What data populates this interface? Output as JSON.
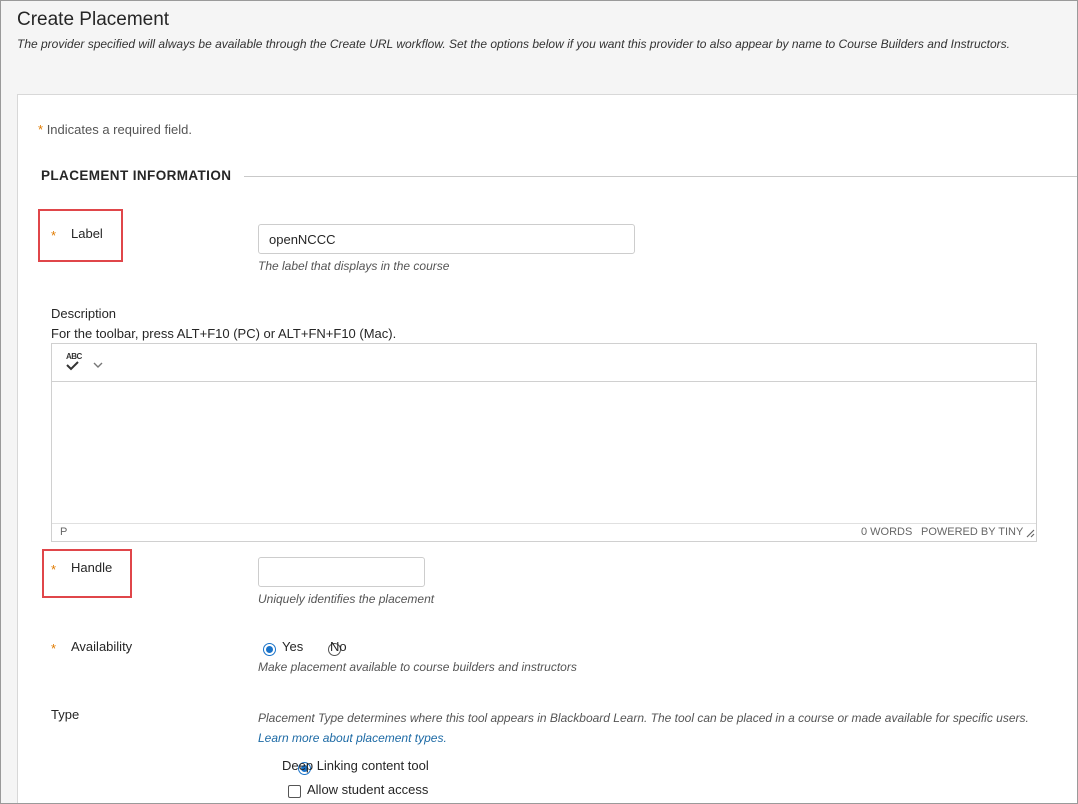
{
  "header": {
    "title": "Create Placement",
    "subtitle": "The provider specified will always be available through the Create URL workflow. Set the options below if you want this provider to also appear by name to Course Builders and Instructors."
  },
  "form": {
    "required_star": "*",
    "required_note": "Indicates a required field.",
    "section_title": "PLACEMENT INFORMATION",
    "label": {
      "title": "Label",
      "value": "openNCCC",
      "hint": "The label that displays in the course"
    },
    "description": {
      "title": "Description",
      "toolbar_help": "For the toolbar, press ALT+F10 (PC) or ALT+FN+F10 (Mac).",
      "spellcheck_icon_text": "ABC",
      "status_path": "P",
      "word_count": "0 WORDS",
      "powered_by": "POWERED BY TINY"
    },
    "handle": {
      "title": "Handle",
      "value": "",
      "hint": "Uniquely identifies the placement"
    },
    "availability": {
      "title": "Availability",
      "options": [
        "Yes",
        "No"
      ],
      "selected": "Yes",
      "hint": "Make placement available to course builders and instructors"
    },
    "type": {
      "title": "Type",
      "description": "Placement Type determines where this tool appears in Blackboard Learn. The tool can be placed in a course or made available for specific users.",
      "link_text": "Learn more about placement types.",
      "option_selected": "Deep Linking content tool",
      "allow_student_access": "Allow student access",
      "allow_student_access_checked": false
    }
  },
  "colors": {
    "accent": "#1a73c9",
    "required": "#e07b00",
    "highlight": "#e0464a",
    "link": "#1d6aa5"
  }
}
